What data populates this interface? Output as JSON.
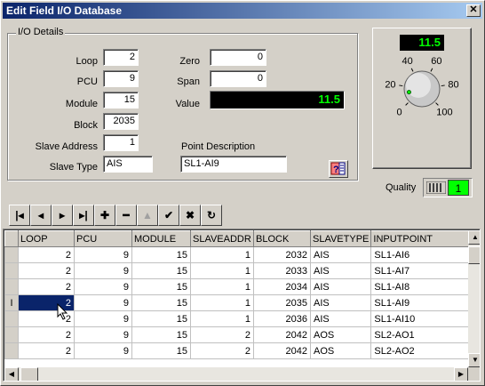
{
  "window": {
    "title": "Edit Field I/O Database",
    "close_label": "✕"
  },
  "details": {
    "legend": "I/O Details",
    "loop_label": "Loop",
    "loop_value": "2",
    "pcu_label": "PCU",
    "pcu_value": "9",
    "module_label": "Module",
    "module_value": "15",
    "block_label": "Block",
    "block_value": "2035",
    "slave_address_label": "Slave Address",
    "slave_address_value": "1",
    "slave_type_label": "Slave Type",
    "slave_type_value": "AIS",
    "zero_label": "Zero",
    "zero_value": "0",
    "span_label": "Span",
    "span_value": "0",
    "value_label": "Value",
    "value_value": "11.5",
    "point_desc_label": "Point Description",
    "point_desc_value": "SL1-AI9"
  },
  "gauge": {
    "readout": "11.5",
    "value": 11.5,
    "ticks": [
      "0",
      "20",
      "40",
      "60",
      "80",
      "100"
    ]
  },
  "quality": {
    "label": "Quality",
    "value": "1"
  },
  "navigator": {
    "buttons": [
      "first-icon",
      "prior-icon",
      "next-icon",
      "last-icon",
      "insert-icon",
      "delete-icon",
      "edit-icon",
      "post-icon",
      "cancel-icon",
      "refresh-icon"
    ]
  },
  "grid": {
    "columns": [
      "LOOP",
      "PCU",
      "MODULE",
      "SLAVEADDR",
      "BLOCK",
      "SLAVETYPE",
      "INPUTPOINT"
    ],
    "rows": [
      [
        "2",
        "9",
        "15",
        "1",
        "2032",
        "AIS",
        "SL1-AI6"
      ],
      [
        "2",
        "9",
        "15",
        "1",
        "2033",
        "AIS",
        "SL1-AI7"
      ],
      [
        "2",
        "9",
        "15",
        "1",
        "2034",
        "AIS",
        "SL1-AI8"
      ],
      [
        "2",
        "9",
        "15",
        "1",
        "2035",
        "AIS",
        "SL1-AI9"
      ],
      [
        "2",
        "9",
        "15",
        "1",
        "2036",
        "AIS",
        "SL1-AI10"
      ],
      [
        "2",
        "9",
        "15",
        "2",
        "2042",
        "AOS",
        "SL2-AO1"
      ],
      [
        "2",
        "9",
        "15",
        "2",
        "2042",
        "AOS",
        "SL2-AO2"
      ]
    ],
    "current_row_marker": "I"
  },
  "colors": {
    "title_start": "#0a246a",
    "title_end": "#a6caf0",
    "led_green": "#00ff00",
    "selection": "#0a246a"
  }
}
